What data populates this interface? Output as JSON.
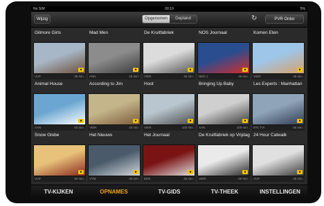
{
  "status": {
    "carrier": "No SIM",
    "time": "00:19",
    "battery": "5%"
  },
  "toolbar": {
    "left_button": "Wijzig",
    "segment": [
      "Opgenomen",
      "Gepland"
    ],
    "active_segment": 0,
    "right_button": "PVR Order"
  },
  "recordings": [
    {
      "title": "Gilmore Girls",
      "channel": "VIJF",
      "duration": "45 min."
    },
    {
      "title": "Mad Men",
      "channel": "ANN",
      "duration": "45 min."
    },
    {
      "title": "De Kruitfabriek",
      "channel": "VIER",
      "duration": "45 min."
    },
    {
      "title": "NOS Journaal",
      "channel": "NED 1",
      "duration": "45 min."
    },
    {
      "title": "Komen Eten",
      "channel": "VIER",
      "duration": "45 min."
    },
    {
      "title": "Animal House",
      "channel": "AAN",
      "duration": "50 min."
    },
    {
      "title": "According to Jim",
      "channel": "VIER",
      "duration": "20 min."
    },
    {
      "title": "Hoot",
      "channel": "VIER",
      "duration": "100 min."
    },
    {
      "title": "Bringing Up Baby",
      "channel": "AAN",
      "duration": "105 min."
    },
    {
      "title": "Les Experts : Manhattan",
      "channel": "RTL TVI",
      "duration": "55 min."
    },
    {
      "title": "Snow Globe",
      "channel": "VIJF",
      "duration": "50 min."
    },
    {
      "title": "Het Nieuws",
      "channel": "VTM",
      "duration": "30 min."
    },
    {
      "title": "Het Journaal",
      "channel": "EEN",
      "duration": "45 min."
    },
    {
      "title": "De Kruitfabriek op Vrijdag",
      "channel": "VIER",
      "duration": "50 min."
    },
    {
      "title": "24 Hour Catwalk",
      "channel": "VIJF",
      "duration": "45 min."
    }
  ],
  "tabs": [
    "TV-KIJKEN",
    "OPNAMES",
    "TV-GIDS",
    "TV-THEEK",
    "INSTELLINGEN"
  ],
  "active_tab": 1,
  "colors": {
    "accent": "#f3a21a",
    "badge": "#f1c400"
  }
}
